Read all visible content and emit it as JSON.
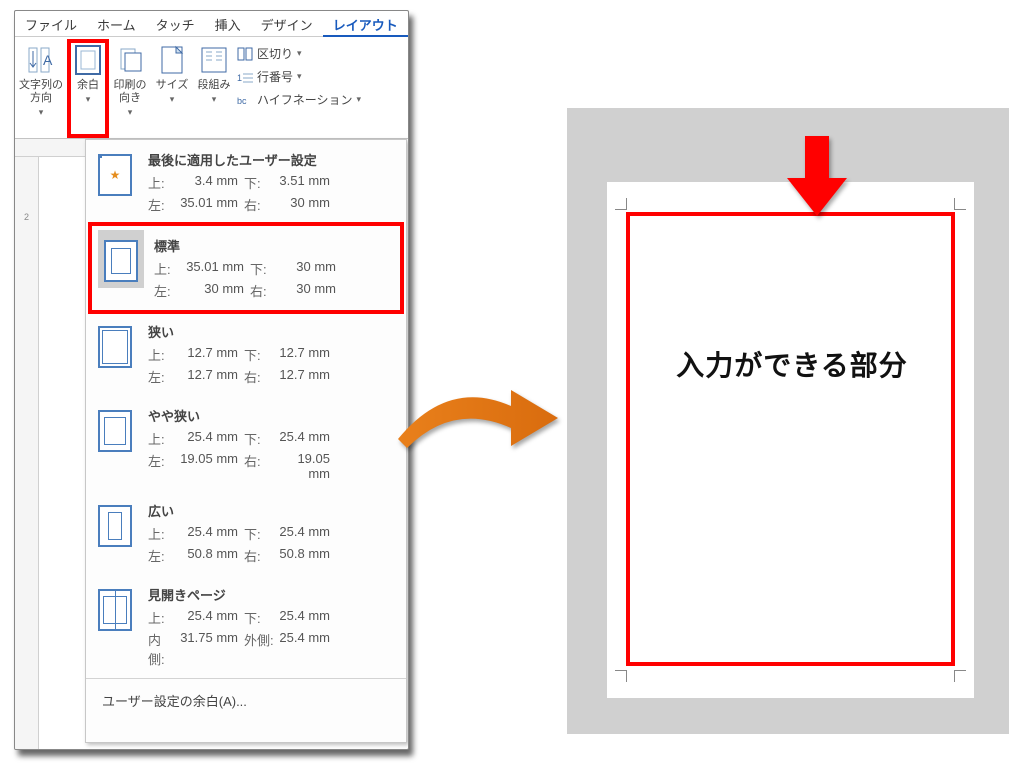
{
  "ribbon": {
    "tabs": [
      "ファイル",
      "ホーム",
      "タッチ",
      "挿入",
      "デザイン",
      "レイアウト"
    ],
    "active_index": 5,
    "groups": {
      "orientation": "文字列の\n方向",
      "margins": "余白",
      "print_orient": "印刷の\n向き",
      "size": "サイズ",
      "columns": "段組み"
    },
    "small": {
      "breaks": "区切り",
      "line_numbers": "行番号",
      "hyphenation": "ハイフネーション"
    }
  },
  "margins_dd": {
    "options": [
      {
        "key": "last",
        "title": "最後に適用したユーザー設定",
        "rows": [
          [
            "上:",
            "3.4 mm",
            "下:",
            "3.51 mm"
          ],
          [
            "左:",
            "35.01 mm",
            "右:",
            "30 mm"
          ]
        ]
      },
      {
        "key": "normal",
        "title": "標準",
        "selected": true,
        "rows": [
          [
            "上:",
            "35.01 mm",
            "下:",
            "30 mm"
          ],
          [
            "左:",
            "30 mm",
            "右:",
            "30 mm"
          ]
        ]
      },
      {
        "key": "narrow",
        "title": "狭い",
        "rows": [
          [
            "上:",
            "12.7 mm",
            "下:",
            "12.7 mm"
          ],
          [
            "左:",
            "12.7 mm",
            "右:",
            "12.7 mm"
          ]
        ]
      },
      {
        "key": "moderate",
        "title": "やや狭い",
        "rows": [
          [
            "上:",
            "25.4 mm",
            "下:",
            "25.4 mm"
          ],
          [
            "左:",
            "19.05 mm",
            "右:",
            "19.05 mm"
          ]
        ]
      },
      {
        "key": "wide",
        "title": "広い",
        "rows": [
          [
            "上:",
            "25.4 mm",
            "下:",
            "25.4 mm"
          ],
          [
            "左:",
            "50.8 mm",
            "右:",
            "50.8 mm"
          ]
        ]
      },
      {
        "key": "mirror",
        "title": "見開きページ",
        "rows": [
          [
            "上:",
            "25.4 mm",
            "下:",
            "25.4 mm"
          ],
          [
            "内側:",
            "31.75 mm",
            "外側:",
            "25.4 mm"
          ]
        ]
      }
    ],
    "footer": "ユーザー設定の余白(A)..."
  },
  "preview": {
    "caption": "入力ができる部分"
  },
  "ruler": {
    "first_mark": "2"
  }
}
